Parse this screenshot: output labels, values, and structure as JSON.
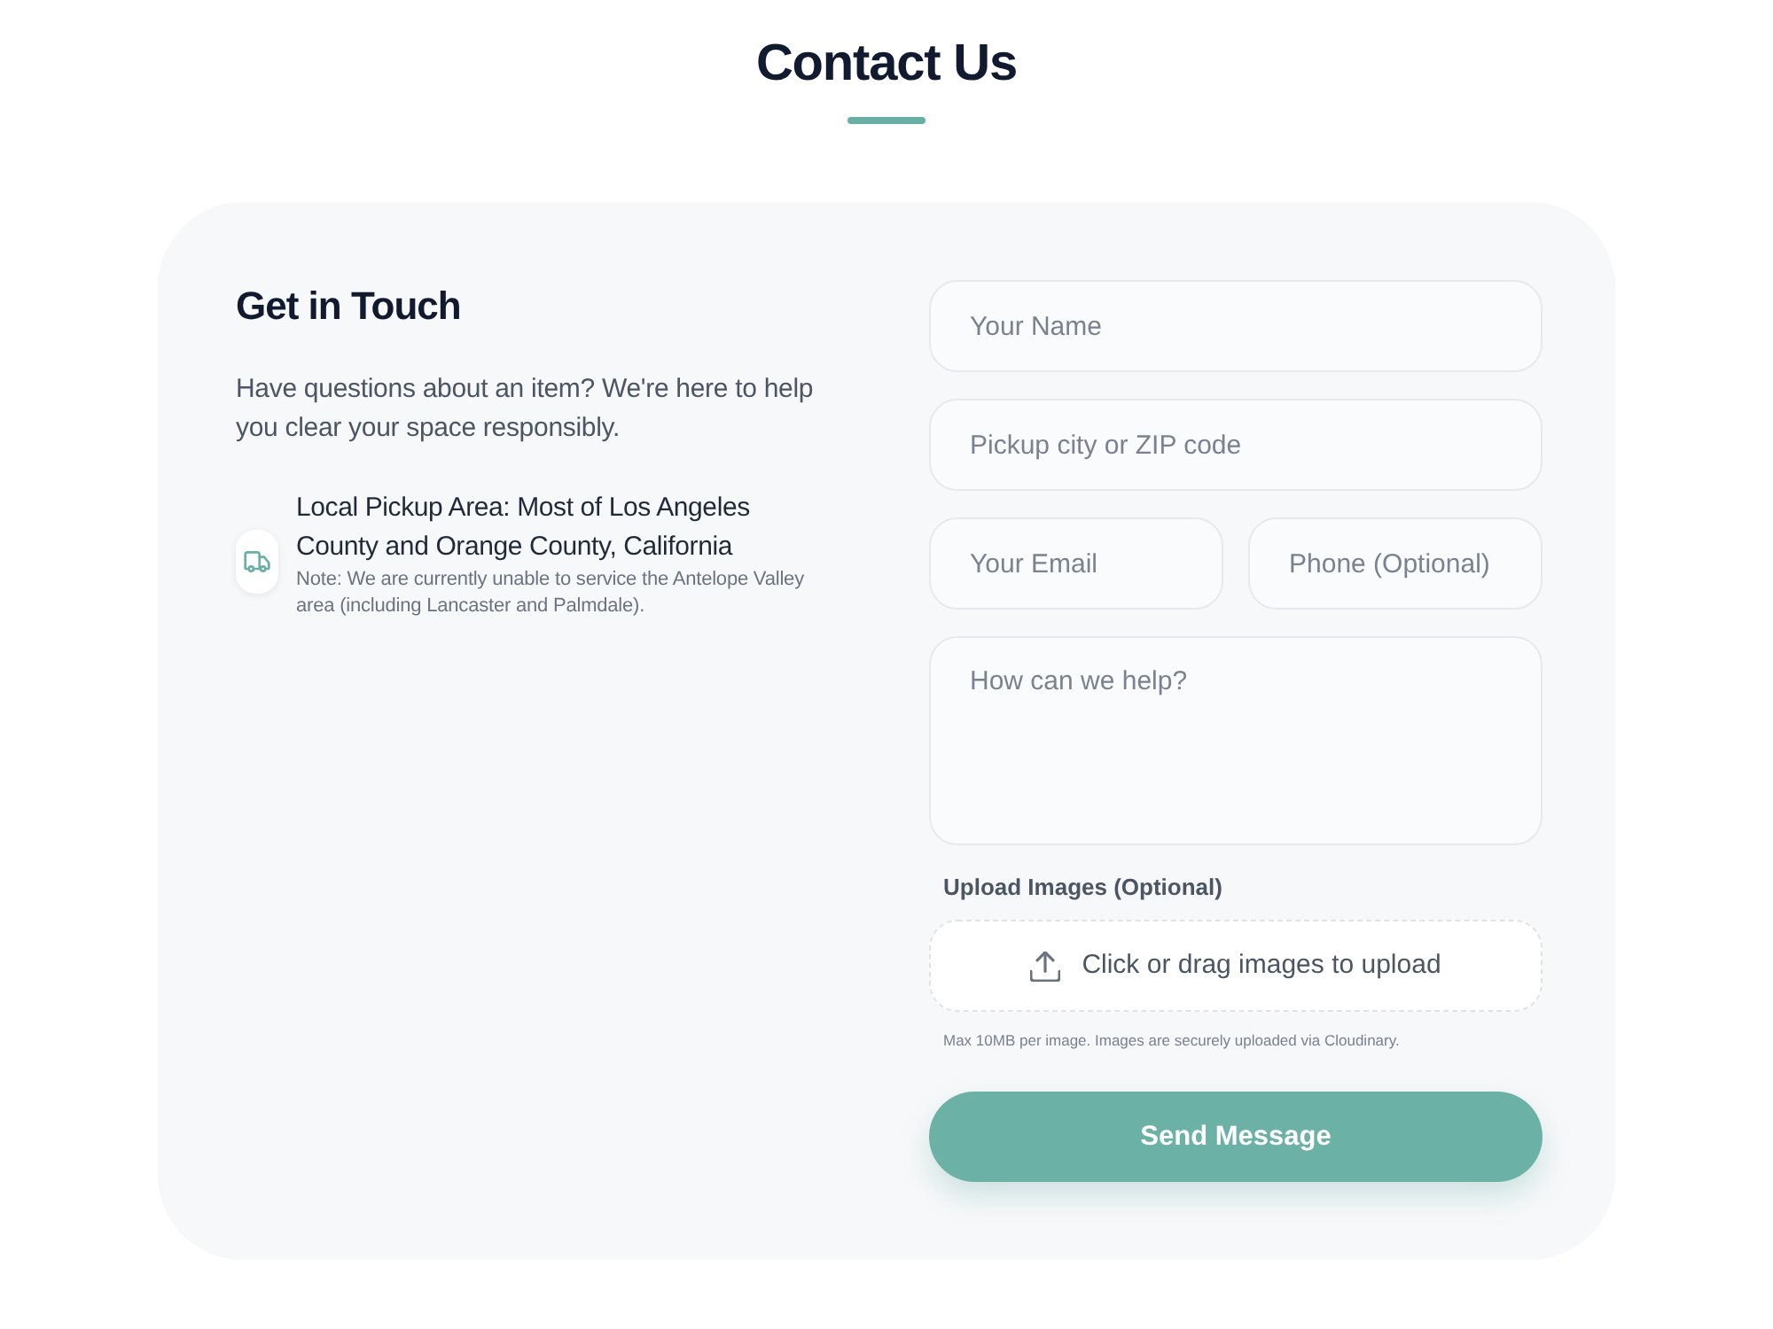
{
  "header": {
    "title": "Contact Us"
  },
  "info": {
    "heading": "Get in Touch",
    "description": "Have questions about an item? We're here to help you clear your space responsibly.",
    "pickup": {
      "title": "Local Pickup Area: Most of Los Angeles County and Orange County, California",
      "note": "Note: We are currently unable to service the Antelope Valley area (including Lancaster and Palmdale)."
    }
  },
  "form": {
    "rows": [
      {
        "fields": [
          {
            "kind": "input",
            "placeholder": "Your Name"
          }
        ]
      },
      {
        "fields": [
          {
            "kind": "input",
            "placeholder": "Pickup city or ZIP code"
          }
        ]
      },
      {
        "fields": [
          {
            "kind": "input",
            "placeholder": "Your Email"
          },
          {
            "kind": "input",
            "placeholder": "Phone (Optional)"
          }
        ]
      },
      {
        "fields": [
          {
            "kind": "textarea",
            "placeholder": "How can we help?"
          }
        ]
      }
    ],
    "upload": {
      "label": "Upload Images (Optional)",
      "prompt": "Click or drag images to upload",
      "hint": "Max 10MB per image. Images are securely uploaded via Cloudinary."
    },
    "submit": "Send Message"
  }
}
